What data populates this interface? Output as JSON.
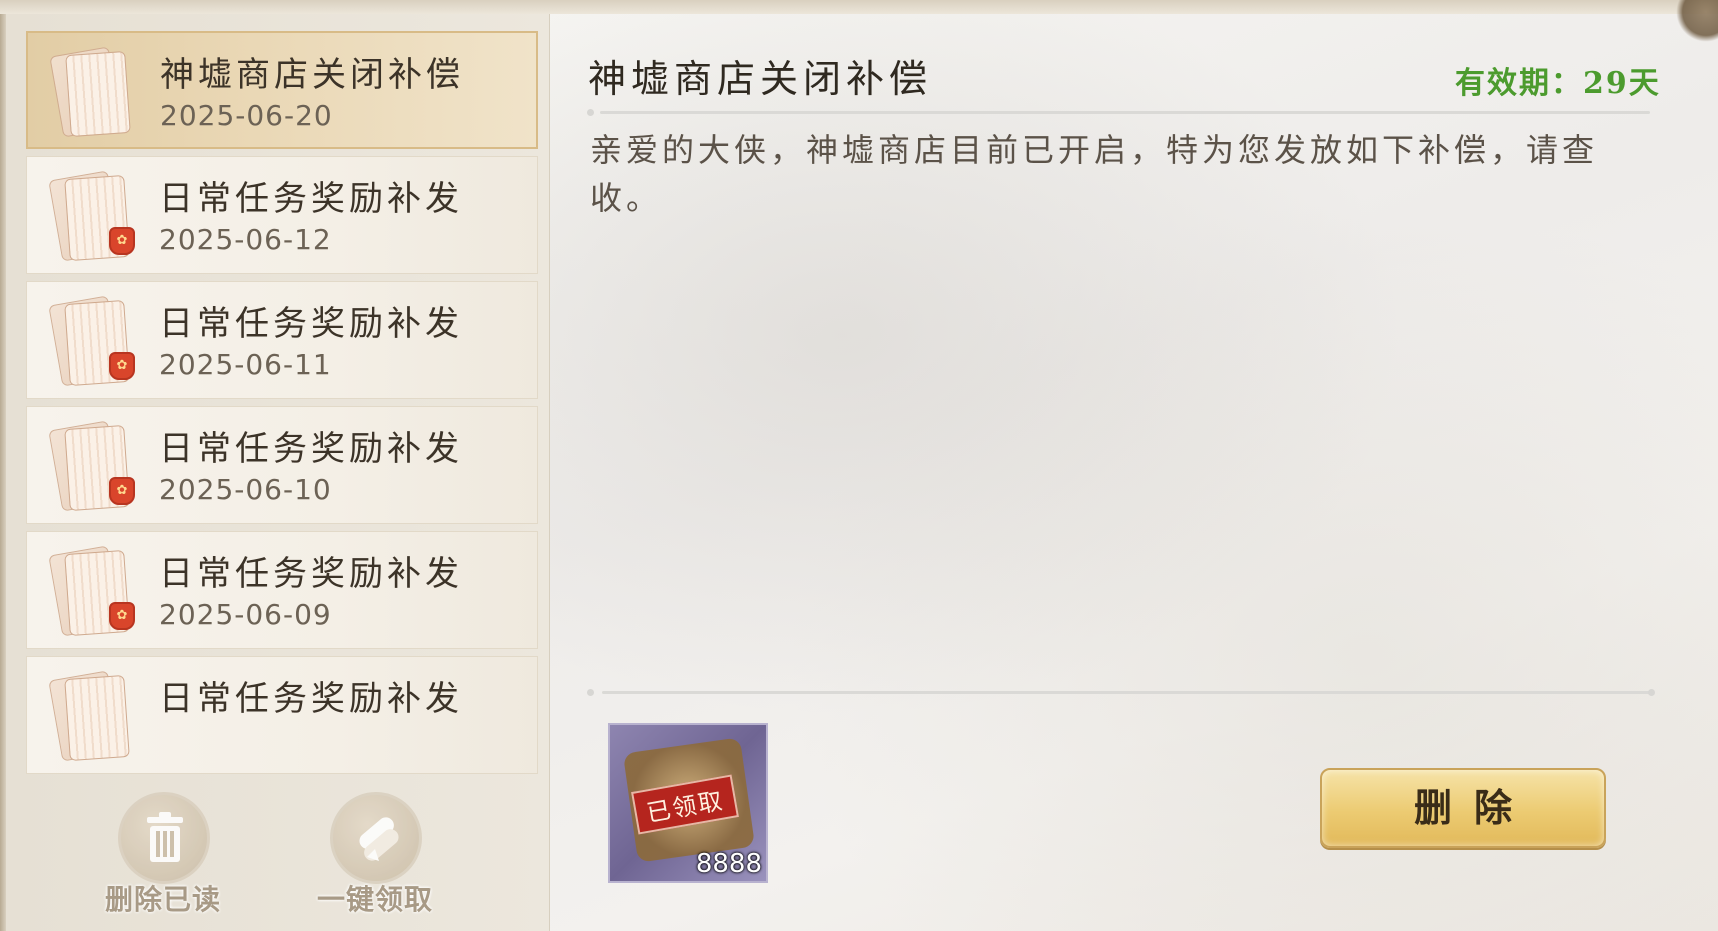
{
  "mails": [
    {
      "title": "神墟商店关闭补偿",
      "date": "2025-06-20",
      "selected": true,
      "has_seal": false
    },
    {
      "title": "日常任务奖励补发",
      "date": "2025-06-12",
      "selected": false,
      "has_seal": true
    },
    {
      "title": "日常任务奖励补发",
      "date": "2025-06-11",
      "selected": false,
      "has_seal": true
    },
    {
      "title": "日常任务奖励补发",
      "date": "2025-06-10",
      "selected": false,
      "has_seal": true
    },
    {
      "title": "日常任务奖励补发",
      "date": "2025-06-09",
      "selected": false,
      "has_seal": true
    },
    {
      "title": "日常任务奖励补发",
      "date": "",
      "selected": false,
      "has_seal": false
    }
  ],
  "actions": {
    "delete_read": "删除已读",
    "claim_all": "一键领取"
  },
  "detail": {
    "title": "神墟商店关闭补偿",
    "validity": "有效期：29天",
    "body": "亲爱的大侠，神墟商店目前已开启，特为您发放如下补偿，请查收。",
    "reward": {
      "badge": "已领取",
      "count": "8888"
    },
    "delete_label": "删除"
  },
  "colors": {
    "validity": "#4c9b2e",
    "selected_item": "#e2cda5",
    "delete_button": "#eccb72",
    "claimed_badge": "#b5251e"
  }
}
